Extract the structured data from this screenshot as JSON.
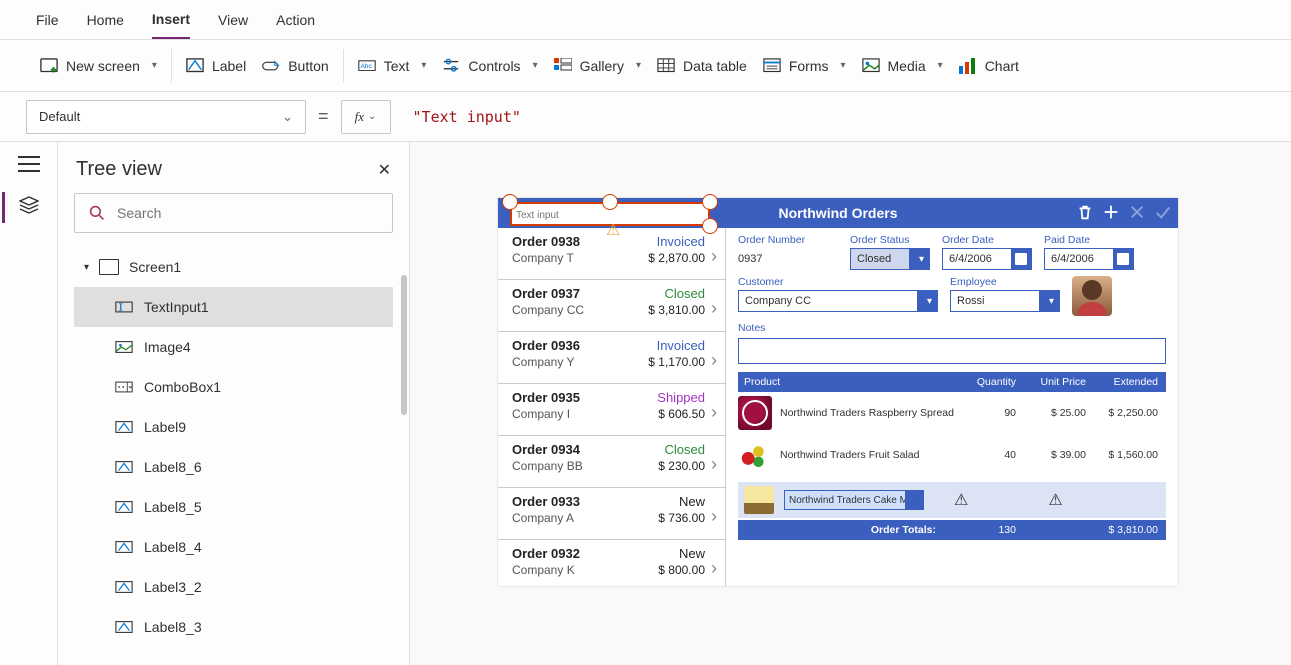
{
  "menubar": {
    "items": [
      "File",
      "Home",
      "Insert",
      "View",
      "Action"
    ],
    "active": "Insert"
  },
  "ribbon": {
    "new_screen": "New screen",
    "label": "Label",
    "button": "Button",
    "text": "Text",
    "controls": "Controls",
    "gallery": "Gallery",
    "data_table": "Data table",
    "forms": "Forms",
    "media": "Media",
    "chart": "Chart"
  },
  "formula": {
    "property": "Default",
    "value": "\"Text input\"",
    "fx": "fx"
  },
  "treeview": {
    "title": "Tree view",
    "search_placeholder": "Search",
    "root": "Screen1",
    "items": [
      "TextInput1",
      "Image4",
      "ComboBox1",
      "Label9",
      "Label8_6",
      "Label8_5",
      "Label8_4",
      "Label3_2",
      "Label8_3"
    ],
    "selected": "TextInput1"
  },
  "selected_input": {
    "placeholder": "Text input"
  },
  "app": {
    "title": "Northwind Orders",
    "orders": [
      {
        "id": "Order 0938",
        "company": "Company T",
        "status": "Invoiced",
        "total": "$ 2,870.00"
      },
      {
        "id": "Order 0937",
        "company": "Company CC",
        "status": "Closed",
        "total": "$ 3,810.00"
      },
      {
        "id": "Order 0936",
        "company": "Company Y",
        "status": "Invoiced",
        "total": "$ 1,170.00"
      },
      {
        "id": "Order 0935",
        "company": "Company I",
        "status": "Shipped",
        "total": "$ 606.50"
      },
      {
        "id": "Order 0934",
        "company": "Company BB",
        "status": "Closed",
        "total": "$ 230.00"
      },
      {
        "id": "Order 0933",
        "company": "Company A",
        "status": "New",
        "total": "$ 736.00"
      },
      {
        "id": "Order 0932",
        "company": "Company K",
        "status": "New",
        "total": "$ 800.00"
      }
    ],
    "detail": {
      "order_number_label": "Order Number",
      "order_number": "0937",
      "order_status_label": "Order Status",
      "order_status": "Closed",
      "order_date_label": "Order Date",
      "order_date": "6/4/2006",
      "paid_date_label": "Paid Date",
      "paid_date": "6/4/2006",
      "customer_label": "Customer",
      "customer": "Company CC",
      "employee_label": "Employee",
      "employee": "Rossi",
      "notes_label": "Notes"
    },
    "grid": {
      "headers": {
        "product": "Product",
        "qty": "Quantity",
        "unit": "Unit Price",
        "ext": "Extended"
      },
      "rows": [
        {
          "name": "Northwind Traders Raspberry Spread",
          "qty": "90",
          "unit": "$ 25.00",
          "ext": "$ 2,250.00",
          "img": "rasp"
        },
        {
          "name": "Northwind Traders Fruit Salad",
          "qty": "40",
          "unit": "$ 39.00",
          "ext": "$ 1,560.00",
          "img": "fruit"
        }
      ],
      "add_select": "Northwind Traders Cake Mix",
      "totals_label": "Order Totals:",
      "totals_qty": "130",
      "totals_ext": "$ 3,810.00"
    }
  }
}
